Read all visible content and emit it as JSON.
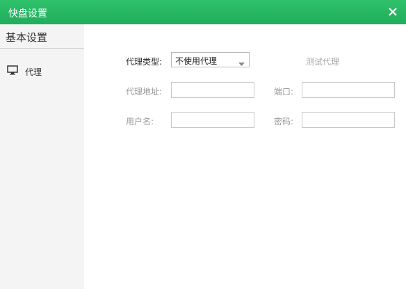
{
  "window": {
    "title": "快盘设置"
  },
  "sidebar": {
    "header": "基本设置",
    "items": [
      {
        "label": "代理",
        "icon": "monitor-icon",
        "selected": true
      }
    ]
  },
  "proxy": {
    "type_label": "代理类型:",
    "type_value": "不使用代理",
    "test_label": "测试代理",
    "address_label": "代理地址:",
    "address_value": "",
    "port_label": "端口:",
    "port_value": "",
    "username_label": "用户名:",
    "username_value": "",
    "password_label": "密码:",
    "password_value": ""
  },
  "colors": {
    "titlebar": "#27b561",
    "sidebar_bg": "#f4f4f4",
    "disabled_text": "#999999"
  }
}
